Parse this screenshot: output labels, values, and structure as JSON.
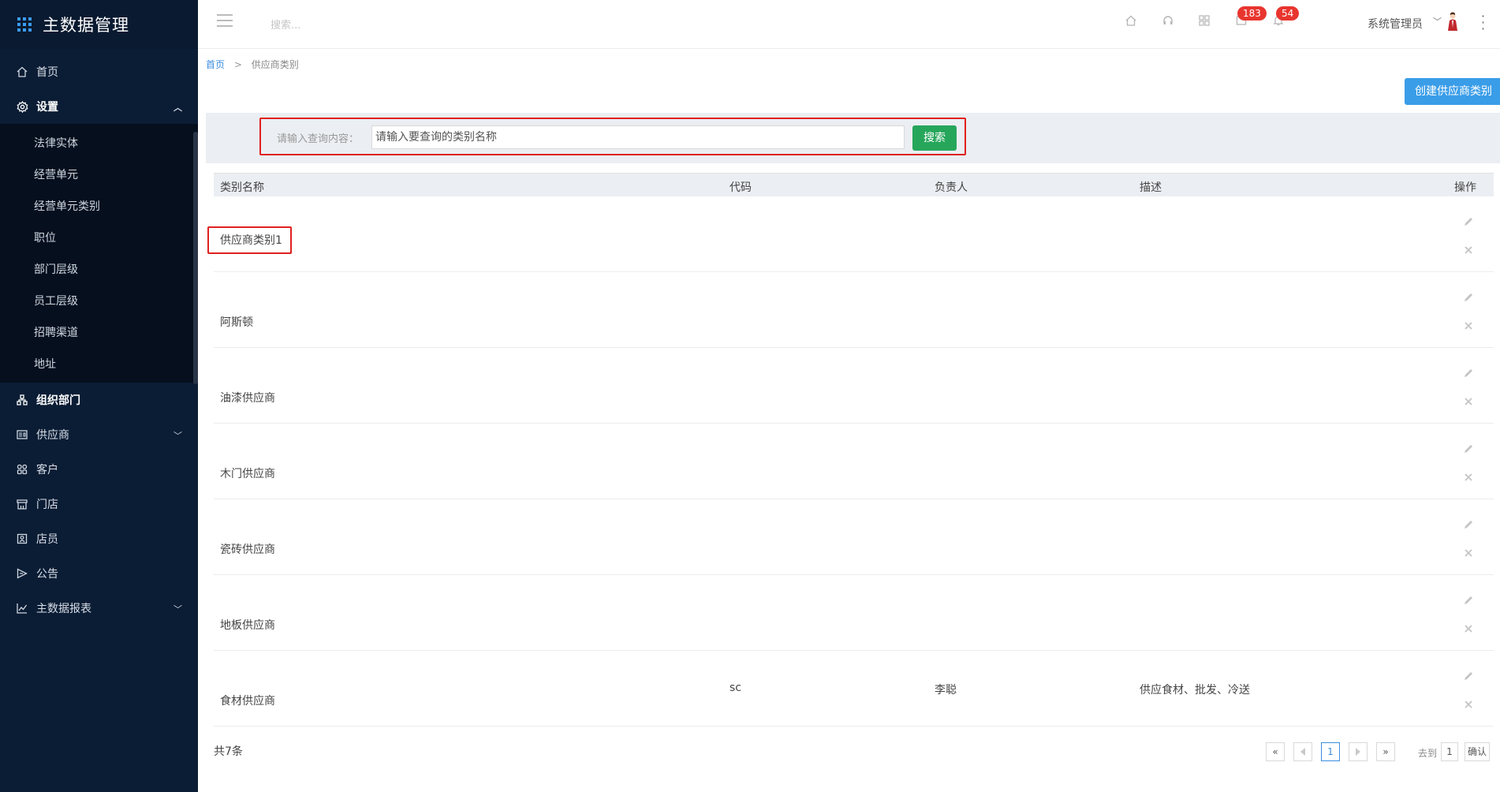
{
  "app": {
    "title": "主数据管理"
  },
  "sidebar": {
    "items": [
      {
        "label": "首页",
        "icon": "home-icon"
      },
      {
        "label": "设置",
        "icon": "gear-icon",
        "active": true,
        "expanded": true
      },
      {
        "label": "组织部门",
        "icon": "org-icon"
      },
      {
        "label": "供应商",
        "icon": "supplier-icon",
        "hasArrow": true
      },
      {
        "label": "客户",
        "icon": "customer-icon"
      },
      {
        "label": "门店",
        "icon": "store-icon"
      },
      {
        "label": "店员",
        "icon": "clerk-icon"
      },
      {
        "label": "公告",
        "icon": "notice-icon"
      },
      {
        "label": "主数据报表",
        "icon": "report-icon",
        "hasArrow": true
      }
    ],
    "settings_sub": [
      {
        "label": "法律实体"
      },
      {
        "label": "经营单元"
      },
      {
        "label": "经营单元类别"
      },
      {
        "label": "职位"
      },
      {
        "label": "部门层级"
      },
      {
        "label": "员工层级"
      },
      {
        "label": "招聘渠道"
      },
      {
        "label": "地址"
      }
    ]
  },
  "header": {
    "search_placeholder": "搜索...",
    "badge_messages": "183",
    "badge_notifications": "54",
    "user_name": "系统管理员"
  },
  "breadcrumb": {
    "home": "首页",
    "separator": ">",
    "current": "供应商类别"
  },
  "toolbar": {
    "create_label": "创建供应商类别"
  },
  "filter": {
    "label": "请输入查询内容：",
    "placeholder": "请输入要查询的类别名称",
    "search_label": "搜索"
  },
  "table": {
    "columns": {
      "name": "类别名称",
      "code": "代码",
      "owner": "负责人",
      "desc": "描述",
      "action": "操作"
    },
    "rows": [
      {
        "name": "供应商类别1",
        "code": "",
        "owner": "",
        "desc": ""
      },
      {
        "name": "阿斯顿",
        "code": "",
        "owner": "",
        "desc": ""
      },
      {
        "name": "油漆供应商",
        "code": "",
        "owner": "",
        "desc": ""
      },
      {
        "name": "木门供应商",
        "code": "",
        "owner": "",
        "desc": ""
      },
      {
        "name": "瓷砖供应商",
        "code": "",
        "owner": "",
        "desc": ""
      },
      {
        "name": "地板供应商",
        "code": "",
        "owner": "",
        "desc": ""
      },
      {
        "name": "食材供应商",
        "code": "sc",
        "owner": "李聪",
        "desc": "供应食材、批发、冷送"
      }
    ]
  },
  "pagination": {
    "total_text": "共7条",
    "first": "«",
    "last": "»",
    "current_page": "1",
    "goto_label": "去到",
    "goto_value": "1",
    "confirm_label": "确认"
  },
  "colors": {
    "sidebar_bg": "#0b1d35",
    "primary": "#3a9de8",
    "search_btn": "#26a65b",
    "badge": "#e8352e",
    "highlight_border": "#e02020"
  }
}
